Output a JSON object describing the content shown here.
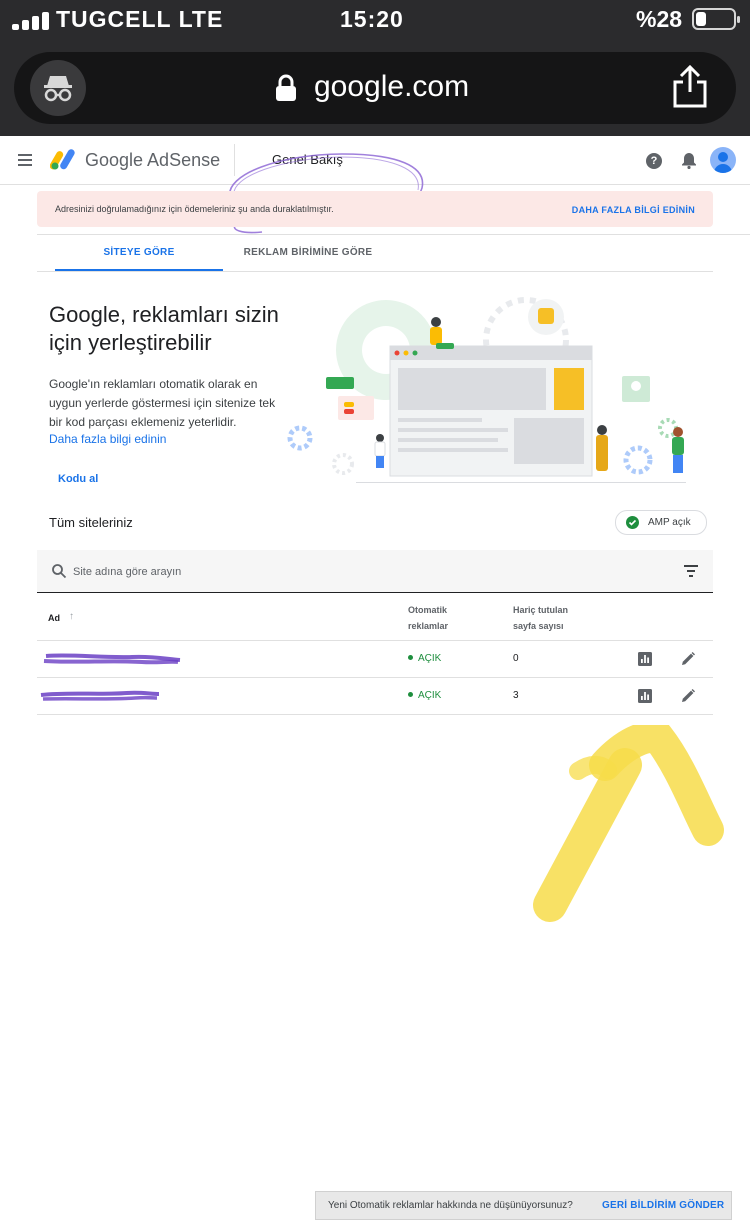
{
  "status_bar": {
    "carrier": "TUGCELL LTE",
    "time": "15:20",
    "battery": "%28"
  },
  "browser": {
    "url": "google.com"
  },
  "app": {
    "brand": "Google AdSense",
    "page_title": "Genel Bakış",
    "help_label": "?"
  },
  "alert": {
    "message": "Adresinizi doğrulamadığınız için ödemeleriniz şu anda duraklatılmıştır.",
    "link": "DAHA FAZLA BİLGİ EDİNİN"
  },
  "tabs": [
    {
      "label": "SİTEYE GÖRE",
      "active": true
    },
    {
      "label": "REKLAM BİRİMİNE GÖRE",
      "active": false
    }
  ],
  "hero": {
    "heading": "Google, reklamları sizin için yerleştirebilir",
    "description": "Google'ın reklamları otomatik olarak en uygun yerlerde göstermesi için sitenize tek bir kod parçası eklemeniz yeterlidir.",
    "learn_more": "Daha fazla bilgi edinin",
    "cta": "Kodu al"
  },
  "sites": {
    "title": "Tüm siteleriniz",
    "amp_label": "AMP açık",
    "search_placeholder": "Site adına göre arayın",
    "columns": {
      "name": "Ad",
      "auto_ads": "Otomatik reklamlar",
      "excluded_pages": "Hariç tutulan sayfa sayısı"
    },
    "rows": [
      {
        "status": "AÇIK",
        "excluded": "0"
      },
      {
        "status": "AÇIK",
        "excluded": "3"
      }
    ]
  },
  "feedback": {
    "question": "Yeni Otomatik reklamlar hakkında ne düşünüyorsunuz?",
    "action": "GERİ BİLDİRİM GÖNDER"
  },
  "colors": {
    "accent": "#1a73e8",
    "status_on": "#1e8e3e",
    "alert_bg": "#fce8e6",
    "annotation_yellow": "#f7dc4a",
    "annotation_purple": "#6a3fc4"
  }
}
